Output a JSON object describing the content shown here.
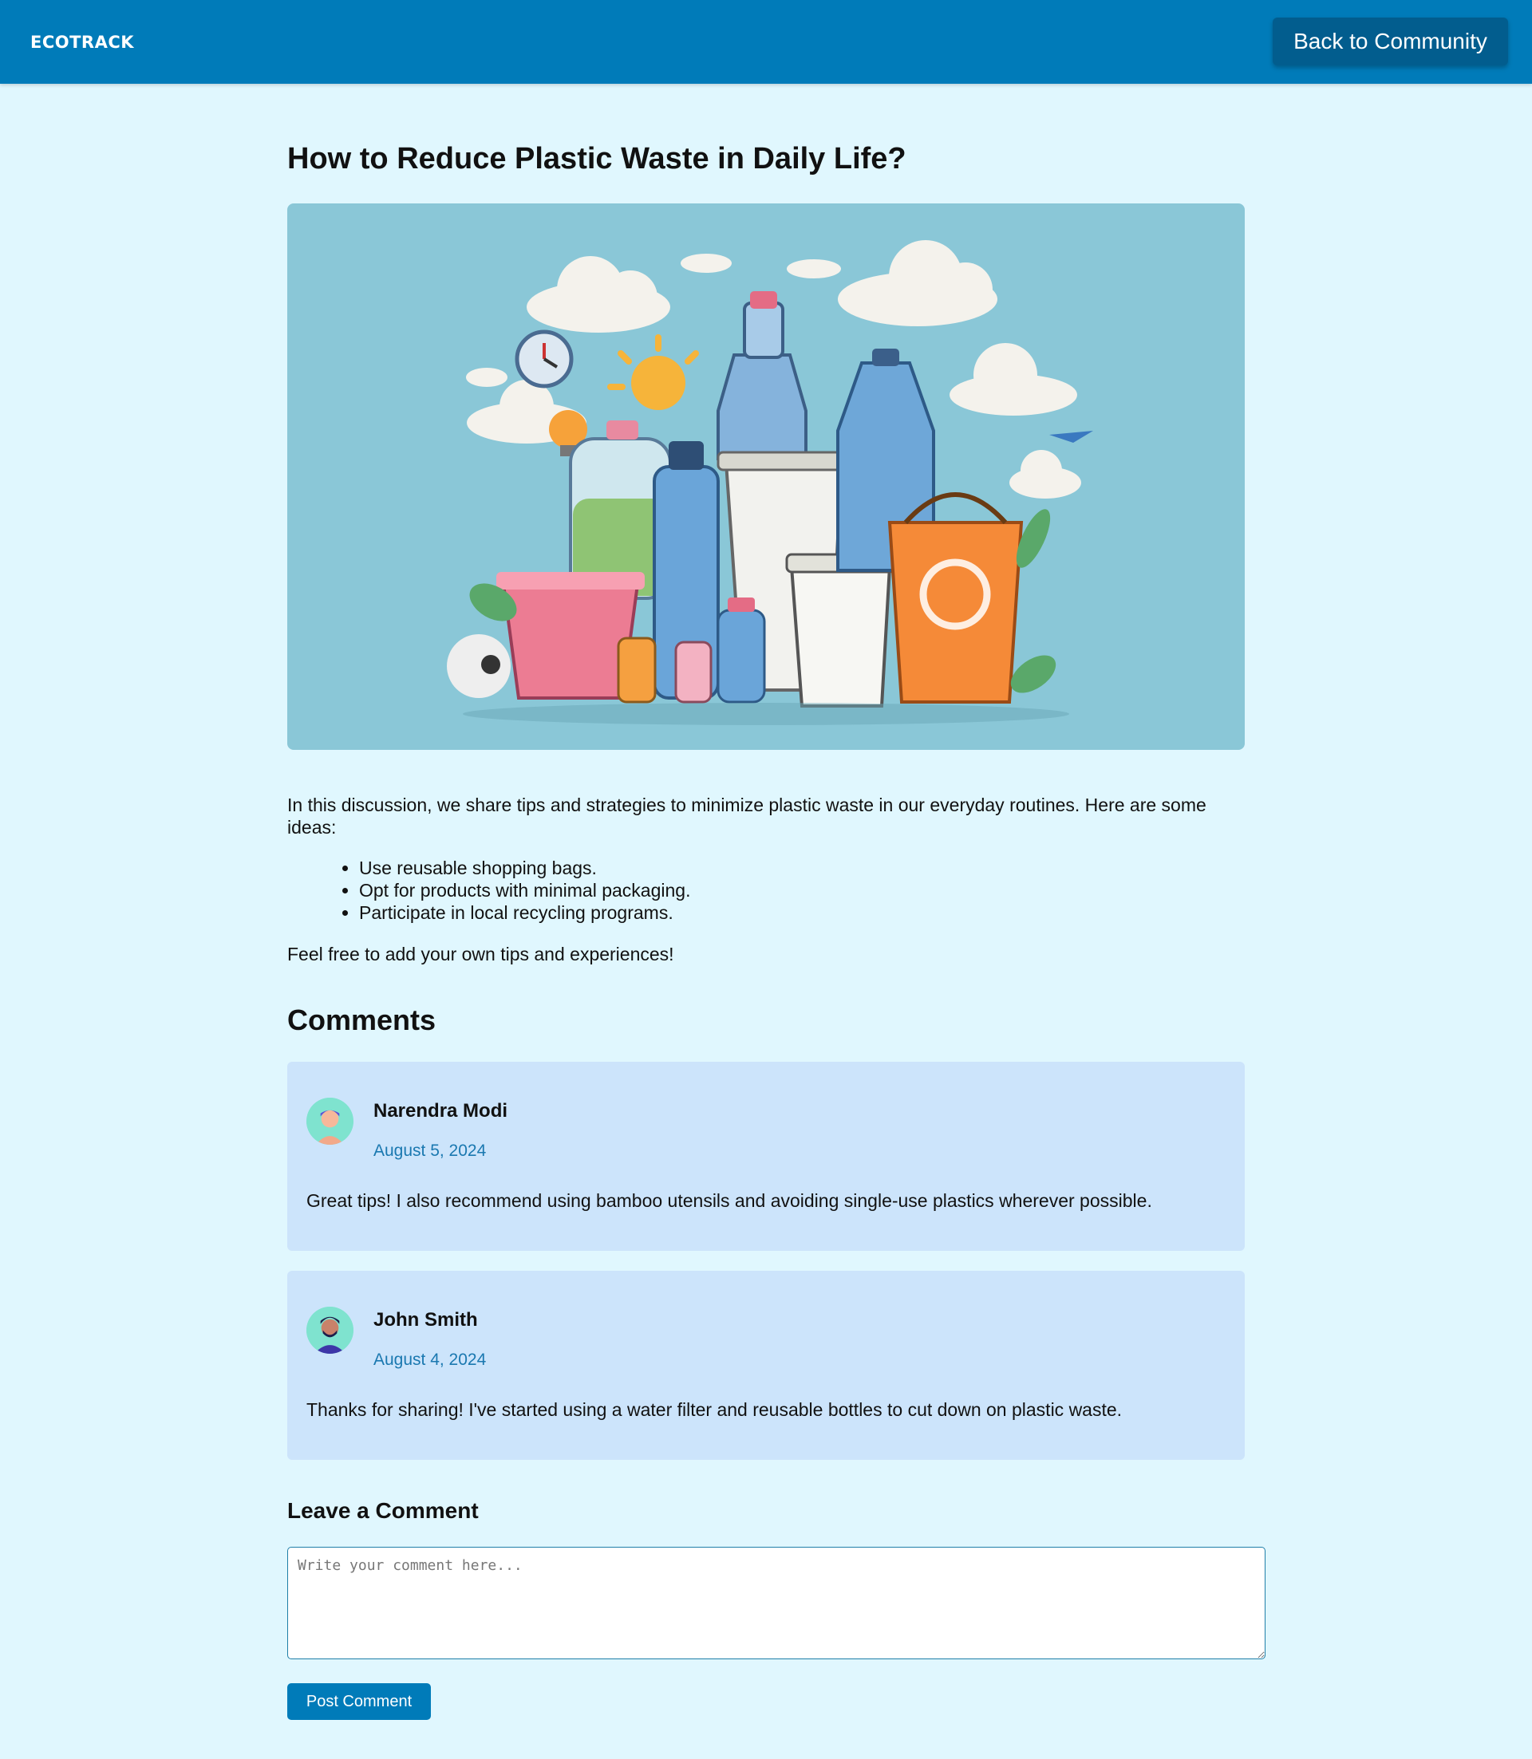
{
  "header": {
    "logo": "ECOTRACK",
    "back_label": "Back to Community"
  },
  "post": {
    "title": "How to Reduce Plastic Waste in Daily Life?",
    "image_description": "plastic-waste-illustration",
    "intro": "In this discussion, we share tips and strategies to minimize plastic waste in our everyday routines. Here are some ideas:",
    "tips": [
      "Use reusable shopping bags.",
      "Opt for products with minimal packaging.",
      "Participate in local recycling programs."
    ],
    "outro": "Feel free to add your own tips and experiences!"
  },
  "comments": {
    "heading": "Comments",
    "items": [
      {
        "author": "Narendra Modi",
        "date": "August 5, 2024",
        "text": "Great tips! I also recommend using bamboo utensils and avoiding single-use plastics wherever possible."
      },
      {
        "author": "John Smith",
        "date": "August 4, 2024",
        "text": "Thanks for sharing! I've started using a water filter and reusable bottles to cut down on plastic waste."
      }
    ]
  },
  "leave_comment": {
    "heading": "Leave a Comment",
    "placeholder": "Write your comment here...",
    "value": "",
    "submit_label": "Post Comment"
  },
  "colors": {
    "page_bg": "#e0f7fe",
    "header_bg": "#007bb9",
    "back_button_bg": "#025d8e",
    "comment_card_bg": "#cce4fb",
    "date_text": "#1a78b0",
    "hero_bg": "#8ac7d7"
  }
}
